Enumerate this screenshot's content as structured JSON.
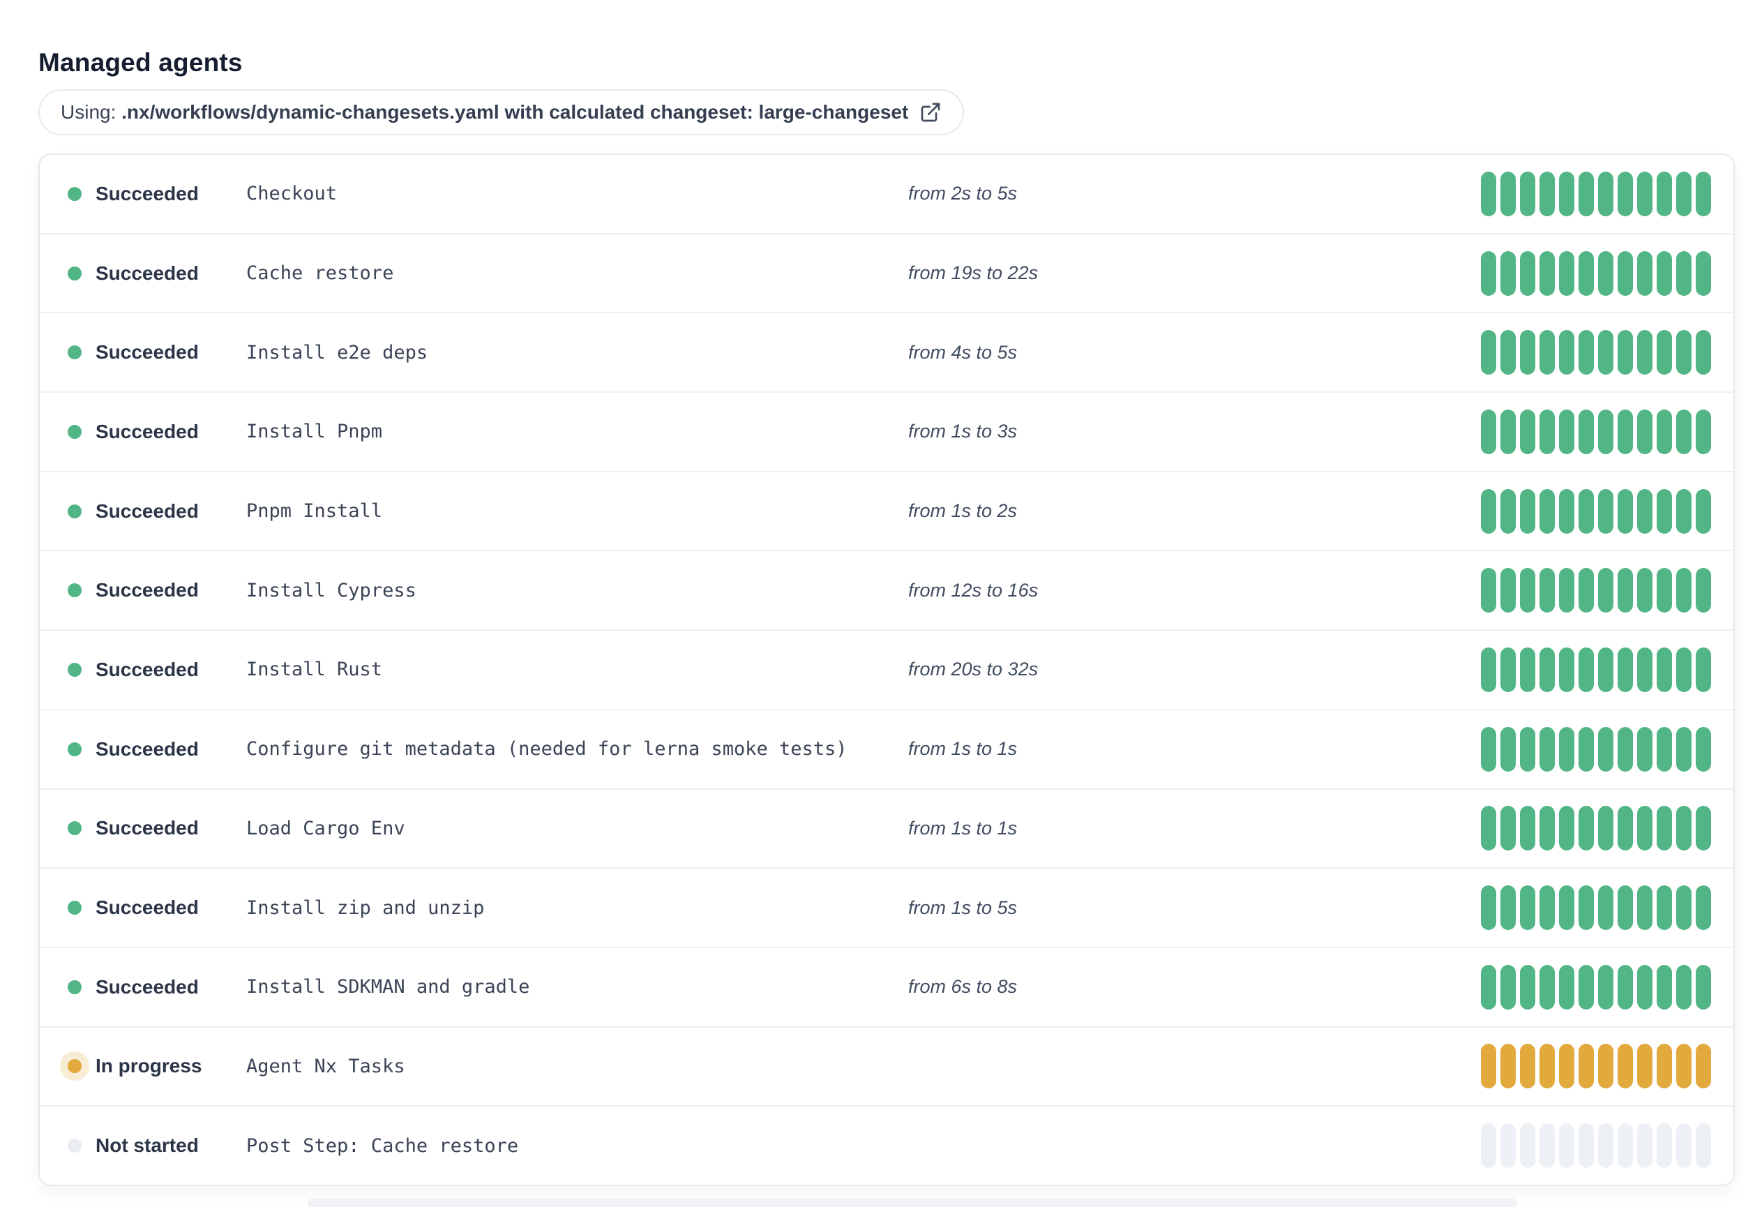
{
  "page": {
    "title": "Managed agents"
  },
  "using_bar": {
    "prefix": "Using: ",
    "detail": ".nx/workflows/dynamic-changesets.yaml with calculated changeset: large-changeset",
    "icon": "external-link-icon"
  },
  "agents_table": {
    "segments_per_bar": 12,
    "rows": [
      {
        "status": "Succeeded",
        "state": "succeeded",
        "name": "Checkout",
        "duration": "from 2s to 5s"
      },
      {
        "status": "Succeeded",
        "state": "succeeded",
        "name": "Cache restore",
        "duration": "from 19s to 22s"
      },
      {
        "status": "Succeeded",
        "state": "succeeded",
        "name": "Install e2e deps",
        "duration": "from 4s to 5s"
      },
      {
        "status": "Succeeded",
        "state": "succeeded",
        "name": "Install Pnpm",
        "duration": "from 1s to 3s"
      },
      {
        "status": "Succeeded",
        "state": "succeeded",
        "name": "Pnpm Install",
        "duration": "from 1s to 2s"
      },
      {
        "status": "Succeeded",
        "state": "succeeded",
        "name": "Install Cypress",
        "duration": "from 12s to 16s"
      },
      {
        "status": "Succeeded",
        "state": "succeeded",
        "name": "Install Rust",
        "duration": "from 20s to 32s"
      },
      {
        "status": "Succeeded",
        "state": "succeeded",
        "name": "Configure git metadata (needed for lerna smoke tests)",
        "duration": "from 1s to 1s"
      },
      {
        "status": "Succeeded",
        "state": "succeeded",
        "name": "Load Cargo Env",
        "duration": "from 1s to 1s"
      },
      {
        "status": "Succeeded",
        "state": "succeeded",
        "name": "Install zip and unzip",
        "duration": "from 1s to 5s"
      },
      {
        "status": "Succeeded",
        "state": "succeeded",
        "name": "Install SDKMAN and gradle",
        "duration": "from 6s to 8s"
      },
      {
        "status": "In progress",
        "state": "in-progress",
        "name": "Agent Nx Tasks",
        "duration": ""
      },
      {
        "status": "Not started",
        "state": "not-started",
        "name": "Post Step: Cache restore",
        "duration": ""
      }
    ]
  },
  "colors": {
    "succeeded": "#52b585",
    "in_progress": "#e2a93d",
    "in_progress_halo": "rgba(226,169,61,0.22)",
    "not_started_segment": "#edf1f6",
    "not_started_dot": "#e9edf2"
  }
}
